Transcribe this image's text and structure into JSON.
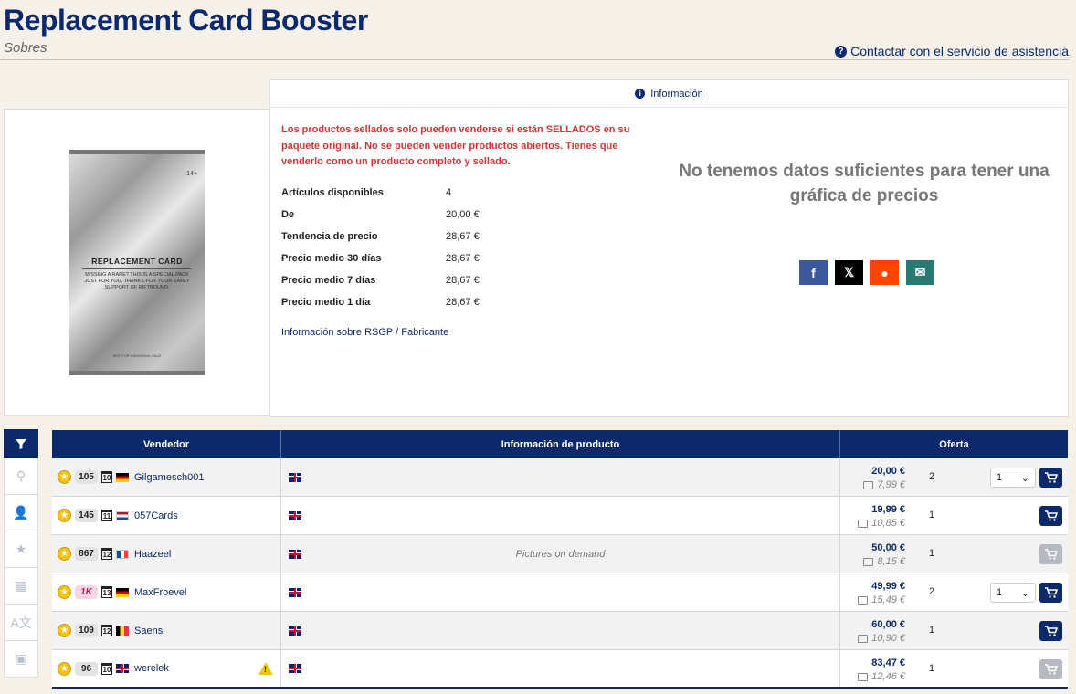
{
  "header": {
    "title": "Replacement Card Booster",
    "subtitle": "Sobres",
    "support_link": "Contactar con el servicio de asistencia"
  },
  "product_image": {
    "age": "14+",
    "title": "REPLACEMENT CARD",
    "description": "MISSING A RARE? THIS IS A SPECIAL PACK JUST FOR YOU. THANKS FOR YOUR EARLY SUPPORT OF RIFTBOUND.",
    "footer": "NOT FOR INDIVIDUAL SALE"
  },
  "info": {
    "tab_label": "Información",
    "warning": "Los productos sellados solo pueden venderse si están SELLADOS en su paquete original. No se pueden vender productos abiertos. Tienes que venderlo como un producto completo y sellado.",
    "stats": [
      {
        "label": "Artículos disponibles",
        "value": "4"
      },
      {
        "label": "De",
        "value": "20,00 €"
      },
      {
        "label": "Tendencia de precio",
        "value": "28,67 €"
      },
      {
        "label": "Precio medio 30 días",
        "value": "28,67 €"
      },
      {
        "label": "Precio medio 7 días",
        "value": "28,67 €"
      },
      {
        "label": "Precio medio 1 día",
        "value": "28,67 €"
      }
    ],
    "rsgp_link": "Información sobre RSGP / Fabricante",
    "no_data_message": "No tenemos datos suficientes para tener una gráfica de precios",
    "social": [
      {
        "icon": "facebook-icon",
        "glyph": "f",
        "color": "#3b5998"
      },
      {
        "icon": "x-icon",
        "glyph": "𝕏",
        "color": "#000000"
      },
      {
        "icon": "reddit-icon",
        "glyph": "●",
        "color": "#ff4500"
      },
      {
        "icon": "email-icon",
        "glyph": "✉",
        "color": "#2a7a72"
      }
    ]
  },
  "table": {
    "col_seller": "Vendedor",
    "col_product": "Información de producto",
    "col_offer": "Oferta",
    "rows": [
      {
        "sales": "105",
        "years": "10",
        "flag": "de",
        "name": "Gilgamesch001",
        "lang": "uk",
        "comment": "",
        "price": "20,00 €",
        "shipping": "7,99 €",
        "qty": "2",
        "select": "1",
        "cart_enabled": true,
        "warning": false,
        "sales_style": ""
      },
      {
        "sales": "145",
        "years": "11",
        "flag": "nl",
        "name": "057Cards",
        "lang": "uk",
        "comment": "",
        "price": "19,99 €",
        "shipping": "10,85 €",
        "qty": "1",
        "select": "",
        "cart_enabled": true,
        "warning": false,
        "sales_style": ""
      },
      {
        "sales": "867",
        "years": "12",
        "flag": "fr",
        "name": "Haazeel",
        "lang": "uk",
        "comment": "Pictures on demand",
        "price": "50,00 €",
        "shipping": "8,15 €",
        "qty": "1",
        "select": "",
        "cart_enabled": false,
        "warning": false,
        "sales_style": ""
      },
      {
        "sales": "1K",
        "years": "13",
        "flag": "de",
        "name": "MaxFroevel",
        "lang": "uk",
        "comment": "",
        "price": "49,99 €",
        "shipping": "15,49 €",
        "qty": "2",
        "select": "1",
        "cart_enabled": true,
        "warning": false,
        "sales_style": "pink"
      },
      {
        "sales": "109",
        "years": "12",
        "flag": "be",
        "name": "Saens",
        "lang": "uk",
        "comment": "",
        "price": "60,00 €",
        "shipping": "10,90 €",
        "qty": "1",
        "select": "",
        "cart_enabled": true,
        "warning": false,
        "sales_style": ""
      },
      {
        "sales": "96",
        "years": "10",
        "flag": "uk",
        "name": "werelek",
        "lang": "uk",
        "comment": "",
        "price": "83,47 €",
        "shipping": "12,46 €",
        "qty": "1",
        "select": "",
        "cart_enabled": false,
        "warning": true,
        "sales_style": ""
      }
    ]
  },
  "filters": [
    {
      "icon": "location-icon",
      "glyph": "⚲"
    },
    {
      "icon": "user-icon",
      "glyph": "👤"
    },
    {
      "icon": "star-icon",
      "glyph": "★"
    },
    {
      "icon": "calendar-icon",
      "glyph": "▦"
    },
    {
      "icon": "language-icon",
      "glyph": "A文"
    },
    {
      "icon": "image-icon",
      "glyph": "▣"
    }
  ]
}
